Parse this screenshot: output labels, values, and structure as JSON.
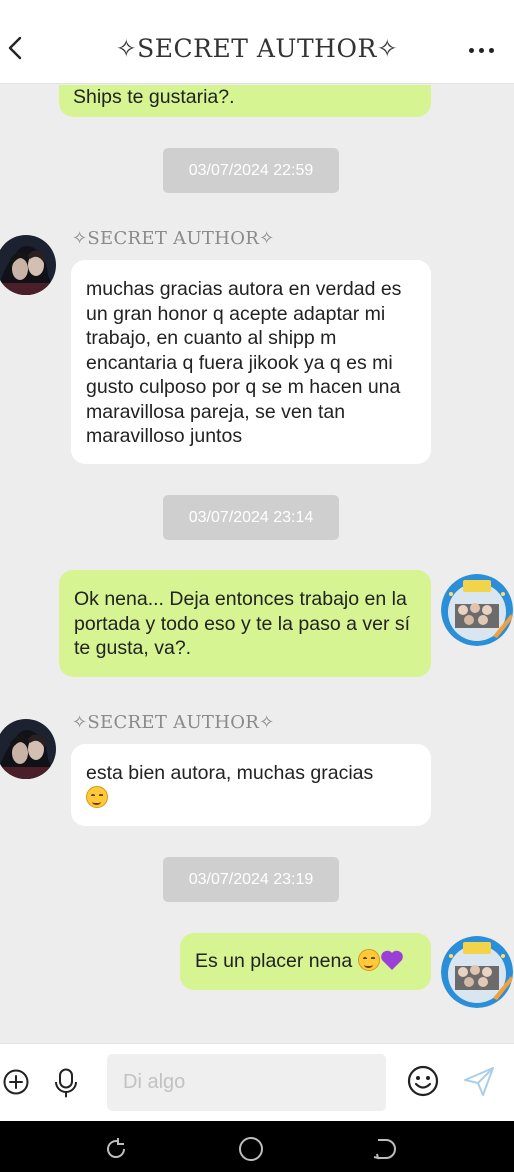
{
  "header": {
    "title": "✧SECRET AUTHOR✧",
    "back_icon": "chevron-left-icon",
    "more_icon": "more-horizontal-icon"
  },
  "messages": [
    {
      "type": "outgoing",
      "text": "Ships te gustaria?."
    },
    {
      "type": "timestamp",
      "text": "03/07/2024 22:59"
    },
    {
      "type": "incoming",
      "sender": "✧SECRET AUTHOR✧",
      "text": "muchas gracias autora en verdad es un gran honor q acepte adaptar mi trabajo, en cuanto al shipp m encantaria q fuera jikook ya q es mi gusto culposo por q se m hacen una maravillosa pareja, se ven tan maravilloso juntos"
    },
    {
      "type": "timestamp",
      "text": "03/07/2024 23:14"
    },
    {
      "type": "outgoing",
      "text": "Ok nena... Deja entonces trabajo en la portada y todo eso y te la paso a ver sí te gusta, va?."
    },
    {
      "type": "incoming",
      "sender": "✧SECRET AUTHOR✧",
      "text": "esta bien autora, muchas gracias",
      "emoji": "smiling-face-emoji"
    },
    {
      "type": "timestamp",
      "text": "03/07/2024 23:19"
    },
    {
      "type": "outgoing",
      "text": "Es un placer nena",
      "emoji": "smiling-face-purple-heart-emoji"
    }
  ],
  "composer": {
    "placeholder": "Di algo",
    "icons": [
      "add-circle-icon",
      "microphone-icon",
      "emoji-icon",
      "send-icon"
    ]
  },
  "system_nav": {
    "icons": [
      "recents-icon",
      "home-icon",
      "back-icon"
    ]
  },
  "colors": {
    "outgoing_bubble": "#d6f491",
    "incoming_bubble": "#ffffff",
    "timestamp_pill": "#cfcfcf",
    "chat_background": "#ededed",
    "send_icon": "#a9cfe8"
  }
}
